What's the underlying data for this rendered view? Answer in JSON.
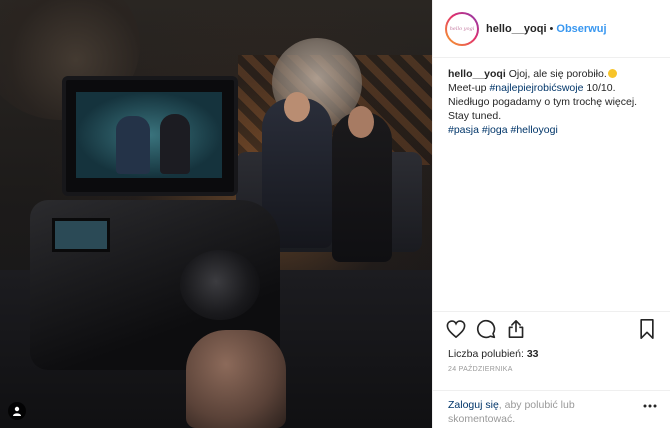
{
  "post": {
    "image_alt": "",
    "tag_icon_glyph": "▲"
  },
  "header": {
    "avatar_text": "hello yogi",
    "username": "hello__yoqi",
    "separator": "•",
    "follow_label": "Obserwuj"
  },
  "caption": {
    "username": "hello__yoqi",
    "line1": "Ojoj, ale się porobiło.",
    "emoji": "grinning-face-emoji",
    "line2_prefix": "Meet-up ",
    "line2_tag": "#najlepiejrobićswoje",
    "line2_suffix": " 10/10.",
    "line3": "Niedługo pogadamy o tym trochę więcej.",
    "line4": "Stay tuned.",
    "tags": [
      "#pasja",
      "#joga",
      "#helloyogi"
    ]
  },
  "actions": {
    "like_icon": "heart-icon",
    "comment_icon": "comment-icon",
    "share_icon": "share-icon",
    "save_icon": "bookmark-icon"
  },
  "likes": {
    "label": "Liczba polubień: ",
    "count": "33"
  },
  "date": "24 PAŹDZIERNIKA",
  "login": {
    "link": "Zaloguj się",
    "text": ", aby polubić lub skomentować.",
    "more_glyph": "•••"
  },
  "colors": {
    "link_blue": "#3897f0",
    "tag_blue": "#003569",
    "muted": "#999999",
    "text": "#262626"
  }
}
